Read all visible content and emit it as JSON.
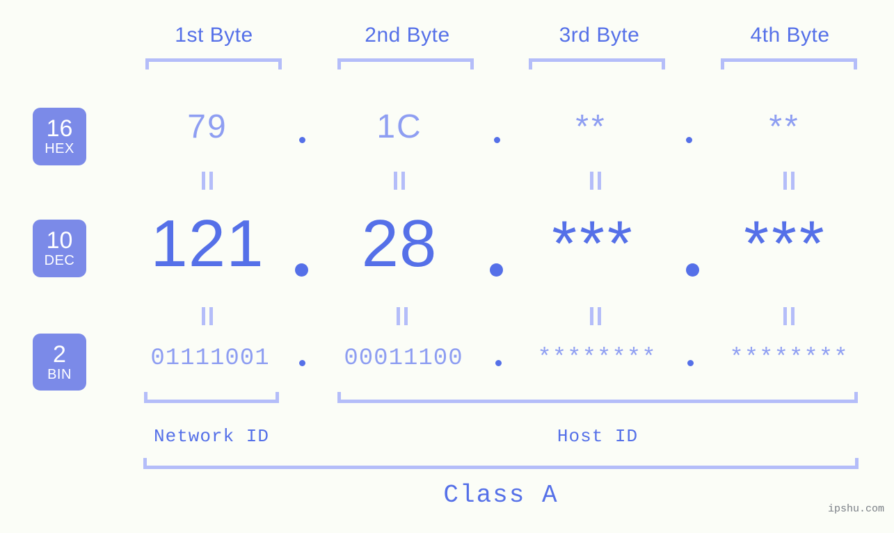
{
  "meta": {
    "background": "#fbfdf7",
    "accent": "#5570e8",
    "accent_light": "#8e9ef2",
    "bracket_color": "#b4bdf9",
    "badge_bg": "#7b8ae8",
    "watermark": "ipshu.com"
  },
  "byte_headers": [
    {
      "label": "1st Byte"
    },
    {
      "label": "2nd Byte"
    },
    {
      "label": "3rd Byte"
    },
    {
      "label": "4th Byte"
    }
  ],
  "bases": [
    {
      "number": "16",
      "name": "HEX"
    },
    {
      "number": "10",
      "name": "DEC"
    },
    {
      "number": "2",
      "name": "BIN"
    }
  ],
  "rows": {
    "hex": {
      "base_number": "16",
      "base_name": "HEX",
      "values": [
        "79",
        "1C",
        "**",
        "**"
      ],
      "separator": "."
    },
    "dec": {
      "base_number": "10",
      "base_name": "DEC",
      "values": [
        "121",
        "28",
        "***",
        "***"
      ],
      "separator": "."
    },
    "bin": {
      "base_number": "2",
      "base_name": "BIN",
      "values": [
        "01111001",
        "00011100",
        "********",
        "********"
      ],
      "separator": "."
    }
  },
  "equals_glyph": "=",
  "segments": [
    {
      "label": "Network ID"
    },
    {
      "label": "Host ID"
    }
  ],
  "class": {
    "label": "Class A"
  }
}
